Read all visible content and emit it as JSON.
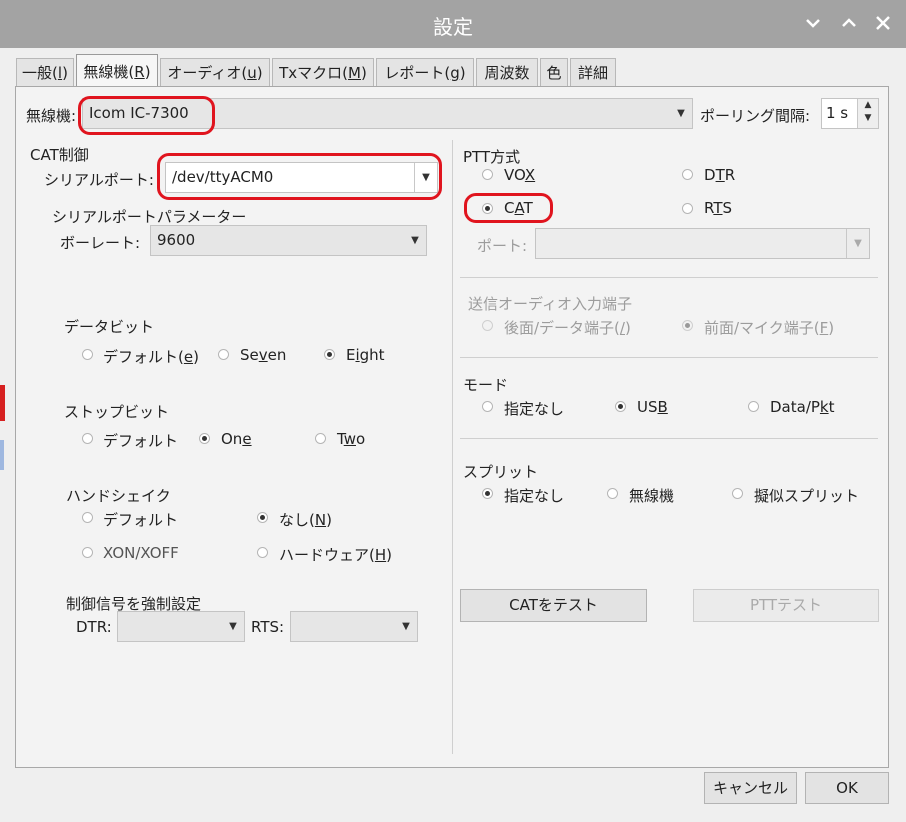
{
  "window": {
    "title": "設定"
  },
  "tabs": [
    {
      "label": "一般(",
      "mn": "l",
      "end": ")"
    },
    {
      "label": "無線機(",
      "mn": "R",
      "end": ")"
    },
    {
      "label": "オーディオ(",
      "mn": "u",
      "end": ")"
    },
    {
      "label": "Txマクロ(",
      "mn": "M",
      "end": ")"
    },
    {
      "label": "レポート(",
      "mn": "g",
      "end": ")"
    },
    {
      "label": "周波数",
      "mn": "",
      "end": ""
    },
    {
      "label": "色",
      "mn": "",
      "end": ""
    },
    {
      "label": "詳細",
      "mn": "",
      "end": ""
    }
  ],
  "radio_row": {
    "label": "無線機:",
    "value": "Icom IC-7300",
    "polling_label": "ポーリング間隔:",
    "polling_value": "1 s"
  },
  "cat": {
    "title": "CAT制御",
    "serial_port_label": "シリアルポート:",
    "serial_port_value": "/dev/ttyACM0",
    "params_title": "シリアルポートパラメーター",
    "baud_label": "ボーレート:",
    "baud_value": "9600",
    "databits": {
      "title": "データビット",
      "opt1": "デフォルト(",
      "opt1_mn": "e",
      "opt2_a": "Se",
      "opt2_mn": "v",
      "opt2_b": "en",
      "opt3_a": "E",
      "opt3_mn": "i",
      "opt3_b": "ght"
    },
    "stopbits": {
      "title": "ストップビット",
      "opt1": "デフォルト",
      "opt2_a": "On",
      "opt2_mn": "e",
      "opt3_a": "T",
      "opt3_mn": "w",
      "opt3_b": "o"
    },
    "handshake": {
      "title": "ハンドシェイク",
      "opt1": "デフォルト",
      "opt2": "なし(",
      "opt2_mn": "N",
      "opt3": "XON/XOFF",
      "opt4": "ハードウェア(",
      "opt4_mn": "H"
    },
    "force": {
      "title": "制御信号を強制設定",
      "dtr_label": "DTR:",
      "rts_label": "RTS:"
    }
  },
  "ptt": {
    "title": "PTT方式",
    "vox_a": "VO",
    "vox_mn": "X",
    "dtr_a": "D",
    "dtr_mn": "T",
    "dtr_b": "R",
    "cat_a": "C",
    "cat_mn": "A",
    "cat_b": "T",
    "rts_a": "R",
    "rts_mn": "T",
    "rts_b": "S",
    "port_label": "ポート:"
  },
  "audio_in": {
    "title": "送信オーディオ入力端子",
    "opt1": "後面/データ端子(",
    "opt1_mn": "/",
    "opt2": "前面/マイク端子(",
    "opt2_mn": "F"
  },
  "mode": {
    "title": "モード",
    "opt1": "指定なし",
    "opt2_a": "US",
    "opt2_mn": "B",
    "opt3_a": "Data/P",
    "opt3_mn": "k",
    "opt3_b": "t"
  },
  "split": {
    "title": "スプリット",
    "opt1": "指定なし",
    "opt2": "無線機",
    "opt3": "擬似スプリット"
  },
  "buttons": {
    "test_cat": "CATをテスト",
    "test_ptt": "PTTテスト",
    "cancel": "キャンセル",
    "ok": "OK"
  },
  "paren_close": ")",
  "colors": {
    "highlight": "#e0141e",
    "titlebar": "#a3a3a3"
  }
}
